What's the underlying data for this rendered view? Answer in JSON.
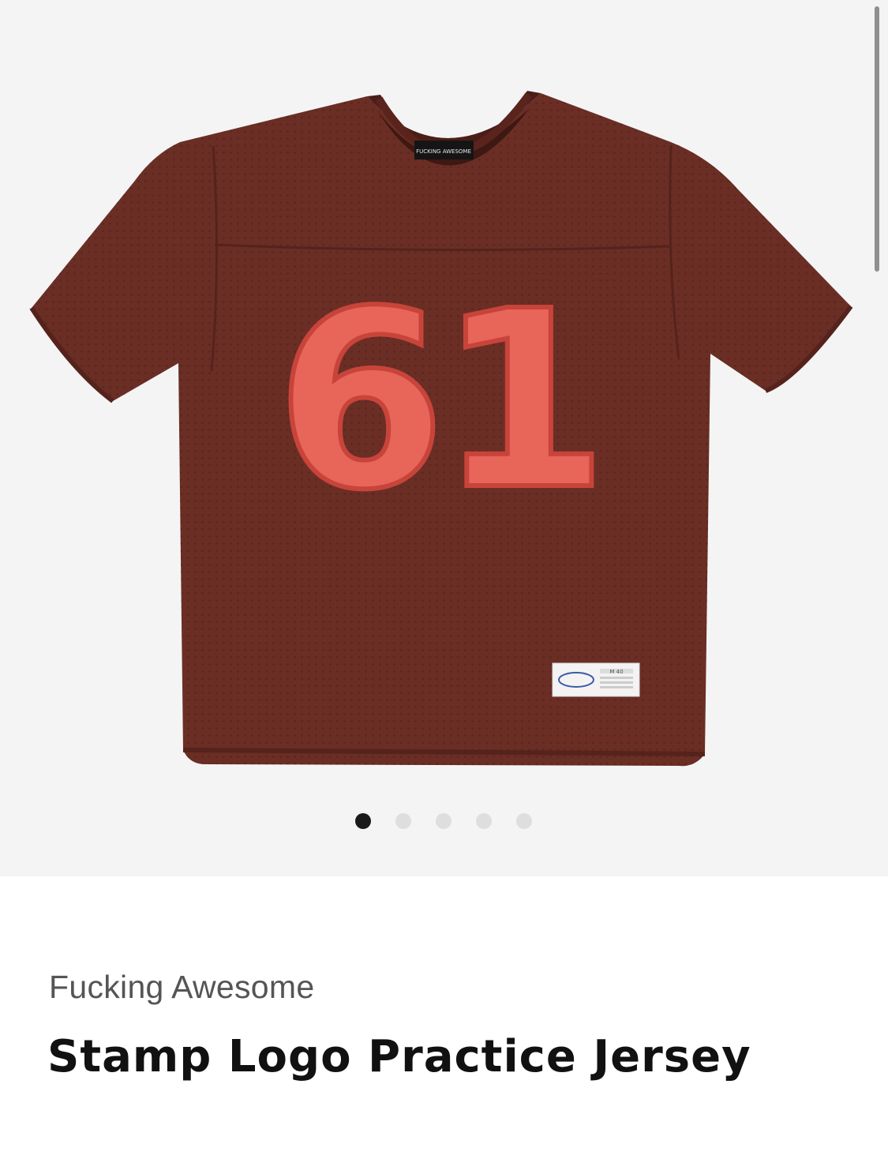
{
  "gallery": {
    "image_alt": "Stamp Logo Practice Jersey, brown mesh jersey with number 61",
    "jersey_number": "61",
    "neck_label": "FUCKING AWESOME",
    "size_tag": "M 40",
    "colors": {
      "background": "#f4f4f4",
      "jersey": "#6a2e25",
      "jersey_dark": "#55231c",
      "number_fill": "#e8655a",
      "number_outline": "#c8443a"
    },
    "pagination": {
      "count": 5,
      "active_index": 0
    }
  },
  "product": {
    "brand": "Fucking Awesome",
    "title": "Stamp Logo Practice Jersey"
  }
}
